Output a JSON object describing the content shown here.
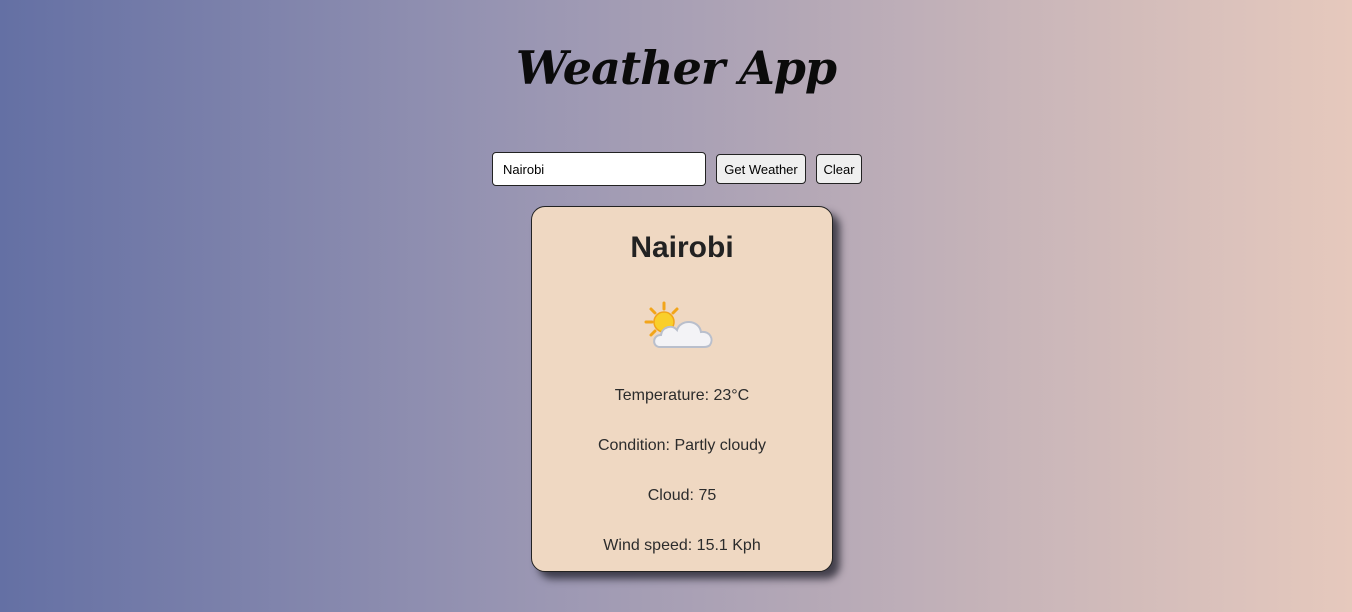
{
  "app": {
    "title": "Weather App"
  },
  "search": {
    "value": "Nairobi",
    "get_weather_label": "Get Weather",
    "clear_label": "Clear"
  },
  "weather": {
    "city": "Nairobi",
    "icon": "partly-cloudy-icon",
    "temperature_text": "Temperature: 23°C",
    "condition_text": "Condition: Partly cloudy",
    "cloud_text": "Cloud: 75",
    "wind_text": "Wind speed: 15.1 Kph"
  },
  "colors": {
    "card_background": "#efd8c2",
    "gradient_start": "#6470a4",
    "gradient_end": "#e6c9bd"
  }
}
